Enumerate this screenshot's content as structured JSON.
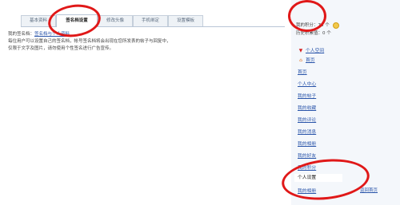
{
  "tabs": [
    {
      "label": "基本资料",
      "active": false
    },
    {
      "label": "签名档设置",
      "active": true
    },
    {
      "label": "修改头像",
      "active": false
    },
    {
      "label": "手机绑定",
      "active": false
    },
    {
      "label": "设置模板",
      "active": false
    }
  ],
  "content": {
    "signature_label": "我的签名档：",
    "signature_link": "签名档与个人资料",
    "help_line_1": "每位用户可以设置自己的签名档，帐号签名档将会出现在您所发表的帖子与回复中，",
    "help_line_2": "仅限于文字及图片，请勿使用个性签名进行广告宣传。"
  },
  "sidebar": {
    "stat_1_label": "我的积分：",
    "stat_1_value": "78 个",
    "stat_2_label": "历史积累值：",
    "stat_2_value": "0 个",
    "nav": [
      {
        "label": "个人空间",
        "icon": "pin-icon"
      },
      {
        "label": "首页",
        "icon": "home-icon"
      }
    ],
    "menu": [
      "首页",
      "个人中心",
      "我的帖子",
      "我的收藏",
      "我的评论",
      "我的消息",
      "我的相册",
      "我的好友",
      "我的积分",
      "个人设置",
      "我的相册"
    ],
    "current_index": 9,
    "more_link": "返回首页"
  },
  "colors": {
    "highlight_ring": "#e01818",
    "link": "#2a55aa",
    "sidebar_bg": "#f4f7fb"
  }
}
